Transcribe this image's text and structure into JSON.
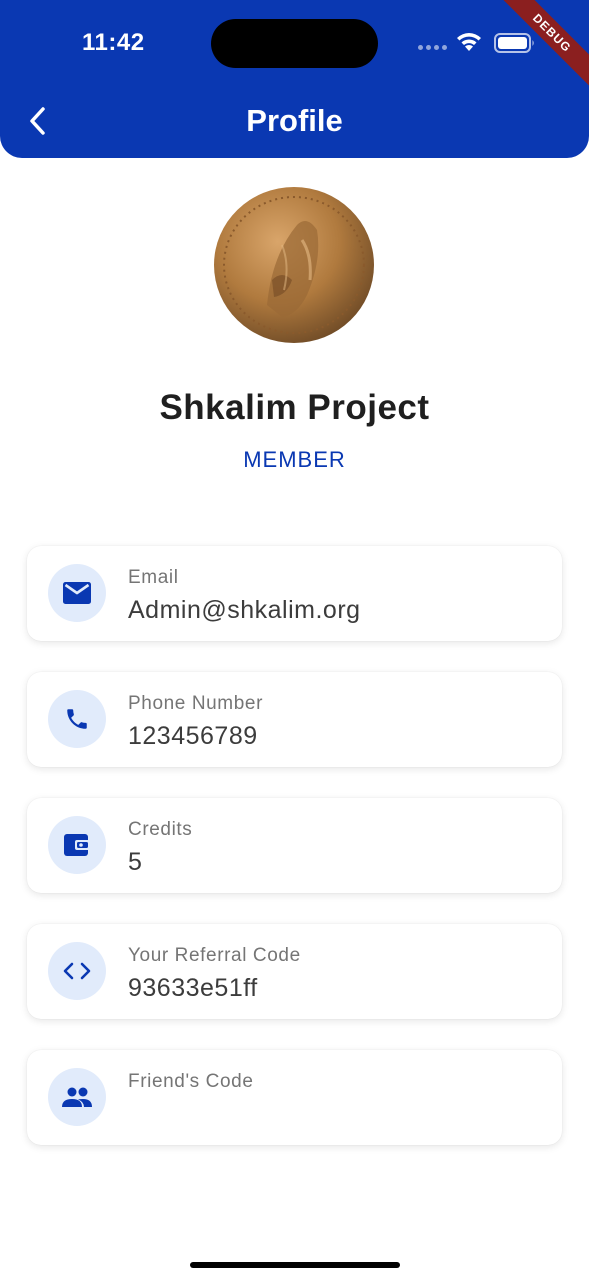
{
  "status_bar": {
    "time": "11:42",
    "debug_label": "DEBUG"
  },
  "header": {
    "title": "Profile",
    "back_icon": "chevron-left-icon"
  },
  "profile": {
    "name": "Shkalim Project",
    "role": "MEMBER",
    "avatar": "bronze-coin-image"
  },
  "fields": [
    {
      "icon": "mail-icon",
      "label": "Email",
      "value": "Admin@shkalim.org"
    },
    {
      "icon": "phone-icon",
      "label": "Phone Number",
      "value": "123456789"
    },
    {
      "icon": "wallet-icon",
      "label": "Credits",
      "value": "5"
    },
    {
      "icon": "code-icon",
      "label": "Your Referral Code",
      "value": "93633e51ff"
    },
    {
      "icon": "people-icon",
      "label": "Friend's Code",
      "value": ""
    }
  ],
  "colors": {
    "primary": "#0a38b2",
    "icon_background": "#e1ebfb",
    "label_text": "#757575",
    "value_text": "#3c3c3c",
    "debug_ribbon": "#8b1f1f"
  }
}
